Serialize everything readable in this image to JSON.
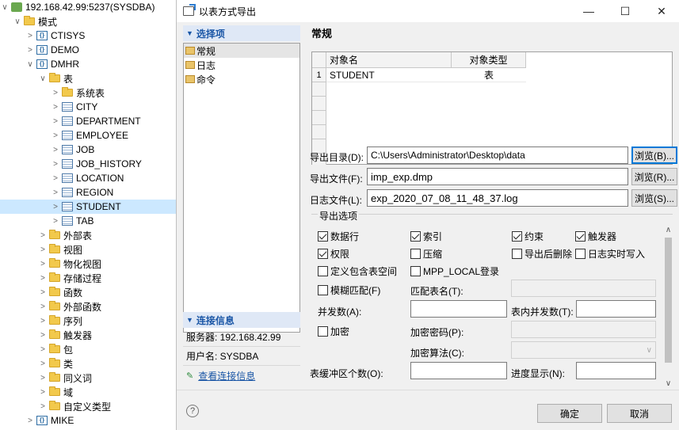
{
  "tree": {
    "connection": "192.168.42.99:5237(SYSDBA)",
    "items": [
      {
        "label": "模式",
        "icon": "folder-icon",
        "depth": 1,
        "arrow": "∨"
      },
      {
        "label": "CTISYS",
        "icon": "schema-icon",
        "depth": 2,
        "arrow": ">"
      },
      {
        "label": "DEMO",
        "icon": "schema-icon",
        "depth": 2,
        "arrow": ">"
      },
      {
        "label": "DMHR",
        "icon": "schema-icon",
        "depth": 2,
        "arrow": "∨"
      },
      {
        "label": "表",
        "icon": "folder-icon",
        "depth": 3,
        "arrow": "∨"
      },
      {
        "label": "系统表",
        "icon": "folder-icon",
        "depth": 4,
        "arrow": ">"
      },
      {
        "label": "CITY",
        "icon": "table-icon",
        "depth": 4,
        "arrow": ">"
      },
      {
        "label": "DEPARTMENT",
        "icon": "table-icon",
        "depth": 4,
        "arrow": ">"
      },
      {
        "label": "EMPLOYEE",
        "icon": "table-icon",
        "depth": 4,
        "arrow": ">"
      },
      {
        "label": "JOB",
        "icon": "table-icon",
        "depth": 4,
        "arrow": ">"
      },
      {
        "label": "JOB_HISTORY",
        "icon": "table-icon",
        "depth": 4,
        "arrow": ">"
      },
      {
        "label": "LOCATION",
        "icon": "table-icon",
        "depth": 4,
        "arrow": ">"
      },
      {
        "label": "REGION",
        "icon": "table-icon",
        "depth": 4,
        "arrow": ">"
      },
      {
        "label": "STUDENT",
        "icon": "table-icon",
        "depth": 4,
        "arrow": ">",
        "selected": true
      },
      {
        "label": "TAB",
        "icon": "table-icon",
        "depth": 4,
        "arrow": ">"
      },
      {
        "label": "外部表",
        "icon": "folder-icon",
        "depth": 3,
        "arrow": ">"
      },
      {
        "label": "视图",
        "icon": "folder-icon",
        "depth": 3,
        "arrow": ">"
      },
      {
        "label": "物化视图",
        "icon": "folder-icon",
        "depth": 3,
        "arrow": ">"
      },
      {
        "label": "存储过程",
        "icon": "folder-icon",
        "depth": 3,
        "arrow": ">"
      },
      {
        "label": "函数",
        "icon": "folder-icon",
        "depth": 3,
        "arrow": ">"
      },
      {
        "label": "外部函数",
        "icon": "folder-icon",
        "depth": 3,
        "arrow": ">"
      },
      {
        "label": "序列",
        "icon": "folder-icon",
        "depth": 3,
        "arrow": ">"
      },
      {
        "label": "触发器",
        "icon": "folder-icon",
        "depth": 3,
        "arrow": ">"
      },
      {
        "label": "包",
        "icon": "folder-icon",
        "depth": 3,
        "arrow": ">"
      },
      {
        "label": "类",
        "icon": "folder-icon",
        "depth": 3,
        "arrow": ">"
      },
      {
        "label": "同义词",
        "icon": "folder-icon",
        "depth": 3,
        "arrow": ">"
      },
      {
        "label": "域",
        "icon": "folder-icon",
        "depth": 3,
        "arrow": ">"
      },
      {
        "label": "自定义类型",
        "icon": "folder-icon",
        "depth": 3,
        "arrow": ">"
      },
      {
        "label": "MIKE",
        "icon": "schema-icon",
        "depth": 2,
        "arrow": ">"
      }
    ]
  },
  "dialog": {
    "title": "以表方式导出",
    "nav": {
      "header": "选择项",
      "items": [
        "常规",
        "日志",
        "命令"
      ]
    },
    "conn": {
      "header": "连接信息",
      "server": "服务器: 192.168.42.99",
      "user": "用户名: SYSDBA",
      "link": "查看连接信息"
    },
    "general": {
      "title": "常规",
      "grid": {
        "columns": [
          "对象名",
          "对象类型"
        ],
        "rows": [
          {
            "num": "1",
            "name": "STUDENT",
            "type": "表"
          }
        ]
      },
      "export_dir_label": "导出目录(D):",
      "export_dir_value": "C:\\Users\\Administrator\\Desktop\\data",
      "export_file_label": "导出文件(F):",
      "export_file_value": "imp_exp.dmp",
      "log_file_label": "日志文件(L):",
      "log_file_value": "exp_2020_07_08_11_48_37.log",
      "browse_dir": "浏览(B)...",
      "browse_file": "浏览(R)...",
      "browse_log": "浏览(S)...",
      "options_label": "导出选项",
      "opt_data_rows": "数据行",
      "opt_index": "索引",
      "opt_constraint": "约束",
      "opt_trigger": "触发器",
      "opt_privilege": "权限",
      "opt_compress": "压缩",
      "opt_delete_after": "导出后删除",
      "opt_log_realtime": "日志实时写入",
      "opt_tablespace": "定义包含表空间",
      "opt_mpp_local": "MPP_LOCAL登录",
      "opt_fuzzy": "模糊匹配(F)",
      "match_table_label": "匹配表名(T):",
      "parallel_label": "并发数(A):",
      "table_parallel_label": "表内并发数(T):",
      "encrypt": "加密",
      "encrypt_pwd_label": "加密密码(P):",
      "encrypt_alg_label": "加密算法(C):",
      "buffer_count_label": "表缓冲区个数(O):",
      "progress_label": "进度显示(N):"
    },
    "ok": "确定",
    "cancel": "取消"
  }
}
